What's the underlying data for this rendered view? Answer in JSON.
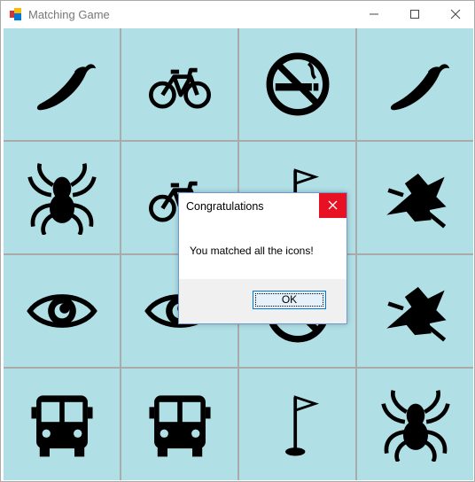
{
  "window": {
    "title": "Matching Game",
    "controls": [
      "minimize",
      "maximize",
      "close"
    ]
  },
  "board": {
    "background_color": "#b0e0e6",
    "cells": [
      [
        "chili-pepper-icon",
        "bicycle-icon",
        "no-smoking-icon",
        "chili-pepper-icon"
      ],
      [
        "spider-icon",
        "bicycle-icon",
        "golf-flag-icon",
        "spider-man-icon"
      ],
      [
        "eye-icon",
        "eye-icon",
        "no-smoking-icon",
        "spider-man-icon"
      ],
      [
        "bus-icon",
        "bus-icon",
        "golf-flag-icon",
        "spider-icon"
      ]
    ]
  },
  "dialog": {
    "title": "Congratulations",
    "message": "You matched all the icons!",
    "ok_label": "OK"
  }
}
